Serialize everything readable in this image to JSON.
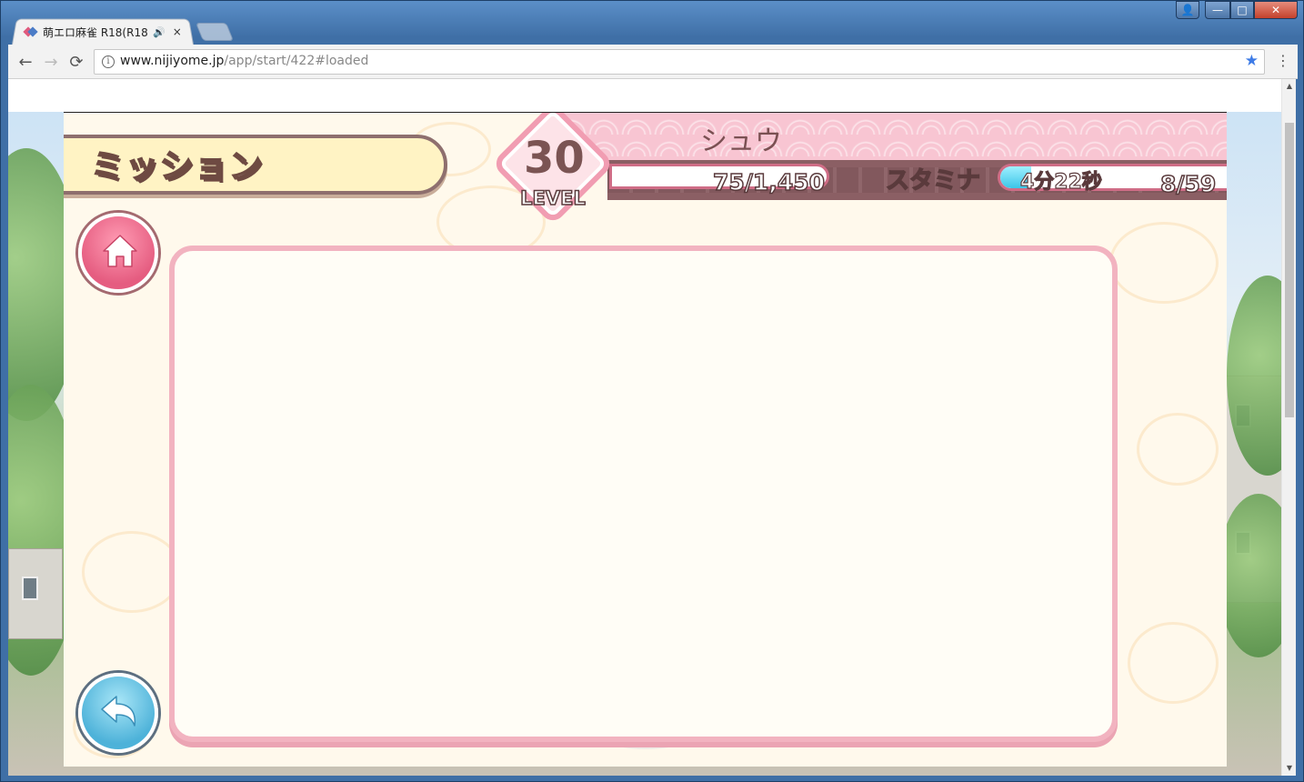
{
  "browser": {
    "tab_title": "萌エロ麻雀 R18(R18",
    "tab_audio": "🔊",
    "tab_close": "×",
    "url_domain": "www.nijiyome.jp",
    "url_path": "/app/start/422#loaded",
    "back": "←",
    "forward": "→",
    "reload": "⟳",
    "info": "i",
    "star": "★",
    "menu": "⋮",
    "win_user": "👤",
    "win_min": "—",
    "win_max": "□",
    "win_close": "✕"
  },
  "game": {
    "screen_title": "ミッション",
    "player_name": "シュウ",
    "level": "30",
    "level_label": "LEVEL",
    "exp": "75/1,450",
    "stamina_label": "スタミナ",
    "stamina_timer": "4分22秒",
    "stamina_count": "8/59",
    "stamina_fill_fraction": 0.136
  },
  "colors": {
    "accent_pink": "#f2b3c0",
    "stamina_blue": "#3cc6e8",
    "banner_yellow": "#fff3c4"
  }
}
